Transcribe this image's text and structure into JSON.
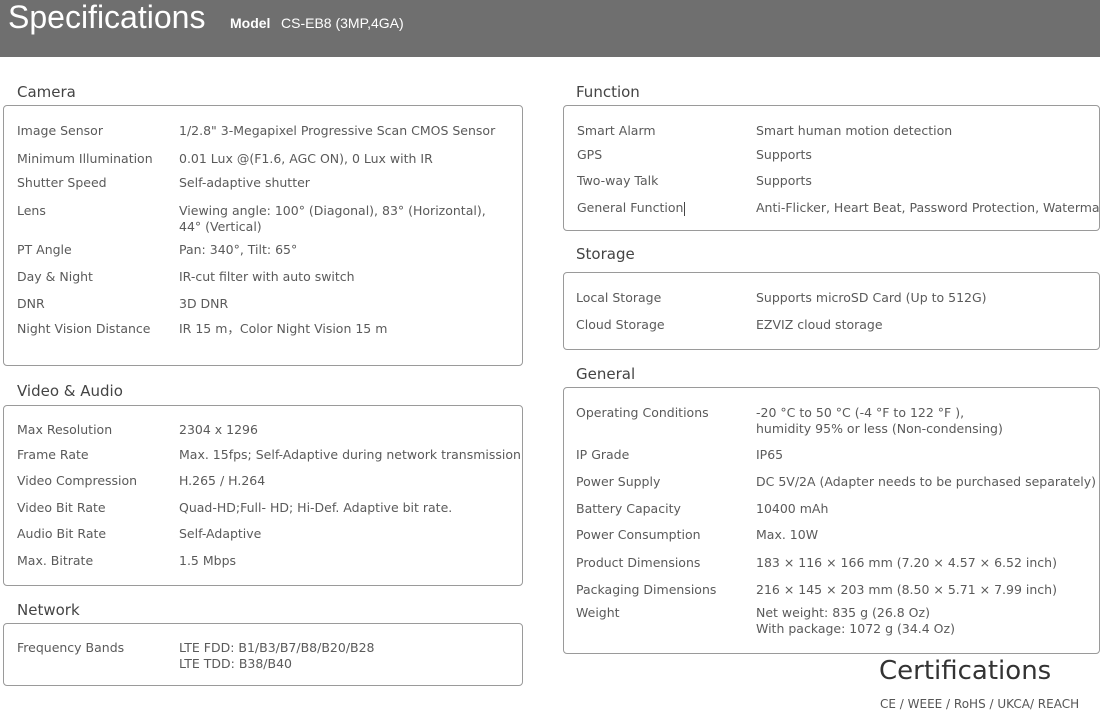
{
  "header": {
    "title": "Specifications",
    "model_label": "Model",
    "model_value": "CS-EB8 (3MP,4GA)"
  },
  "camera": {
    "title": "Camera",
    "rows": [
      {
        "label": "Image Sensor",
        "value": [
          "1/2.8\" 3-Megapixel Progressive Scan CMOS Sensor"
        ]
      },
      {
        "label": "Minimum Illumination",
        "value": [
          "0.01 Lux @(F1.6, AGC ON), 0 Lux with IR"
        ]
      },
      {
        "label": "Shutter Speed",
        "value": [
          "Self-adaptive shutter"
        ]
      },
      {
        "label": "Lens",
        "value": [
          "Viewing angle: 100° (Diagonal), 83° (Horizontal),",
          "44° (Vertical)"
        ]
      },
      {
        "label": "PT Angle",
        "value": [
          "Pan: 340°, Tilt: 65°"
        ]
      },
      {
        "label": "Day & Night",
        "value": [
          "IR-cut filter with auto switch"
        ]
      },
      {
        "label": "DNR",
        "value": [
          "3D DNR"
        ]
      },
      {
        "label": "Night Vision Distance",
        "value": [
          "IR 15 m，Color Night Vision 15 m"
        ]
      }
    ]
  },
  "video": {
    "title": "Video & Audio",
    "rows": [
      {
        "label": "Max Resolution",
        "value": [
          "2304 x 1296"
        ]
      },
      {
        "label": "Frame Rate",
        "value": [
          "Max. 15fps; Self-Adaptive during network transmission"
        ]
      },
      {
        "label": "Video Compression",
        "value": [
          "H.265 / H.264"
        ]
      },
      {
        "label": "Video Bit Rate",
        "value": [
          "Quad-HD;Full- HD; Hi-Def. Adaptive bit rate."
        ]
      },
      {
        "label": "Audio Bit Rate",
        "value": [
          "Self-Adaptive"
        ]
      },
      {
        "label": "Max. Bitrate",
        "value": [
          "1.5 Mbps"
        ]
      }
    ]
  },
  "network": {
    "title": "Network",
    "rows": [
      {
        "label": "Frequency Bands",
        "value": [
          "LTE FDD: B1/B3/B7/B8/B20/B28",
          "LTE TDD: B38/B40"
        ]
      }
    ]
  },
  "function": {
    "title": "Function",
    "rows": [
      {
        "label": "Smart Alarm",
        "value": [
          "Smart human motion detection"
        ]
      },
      {
        "label": "GPS",
        "value": [
          "Supports"
        ]
      },
      {
        "label": "Two-way Talk",
        "value": [
          "Supports"
        ]
      },
      {
        "label": "General Function",
        "value": [
          "Anti-Flicker, Heart Beat, Password Protection, Watermark"
        ]
      }
    ]
  },
  "storage": {
    "title": "Storage",
    "rows": [
      {
        "label": "Local Storage",
        "value": [
          "Supports microSD Card (Up to 512G)"
        ]
      },
      {
        "label": "Cloud Storage",
        "value": [
          "EZVIZ cloud storage"
        ]
      }
    ]
  },
  "general": {
    "title": "General",
    "rows": [
      {
        "label": "Operating Conditions",
        "value": [
          "-20 °C to 50 °C (-4 °F to 122 °F ),",
          "humidity 95% or less (Non-condensing)"
        ]
      },
      {
        "label": "IP Grade",
        "value": [
          "IP65"
        ]
      },
      {
        "label": "Power Supply",
        "value": [
          "DC 5V/2A  (Adapter needs to be purchased separately)"
        ]
      },
      {
        "label": "Battery Capacity",
        "value": [
          "10400 mAh"
        ]
      },
      {
        "label": "Power Consumption",
        "value": [
          "Max. 10W"
        ]
      },
      {
        "label": "Product Dimensions",
        "value": [
          "183 × 116 × 166 mm (7.20 × 4.57 × 6.52 inch)"
        ]
      },
      {
        "label": "Packaging Dimensions",
        "value": [
          "216 × 145 × 203 mm (8.50 × 5.71 × 7.99 inch)"
        ]
      },
      {
        "label": "Weight",
        "value": [
          "Net weight: 835 g (26.8 Oz)",
          "With package: 1072 g (34.4 Oz)"
        ]
      }
    ]
  },
  "certifications": {
    "title": "Certifications",
    "list": "CE / WEEE / RoHS / UKCA/ REACH"
  }
}
